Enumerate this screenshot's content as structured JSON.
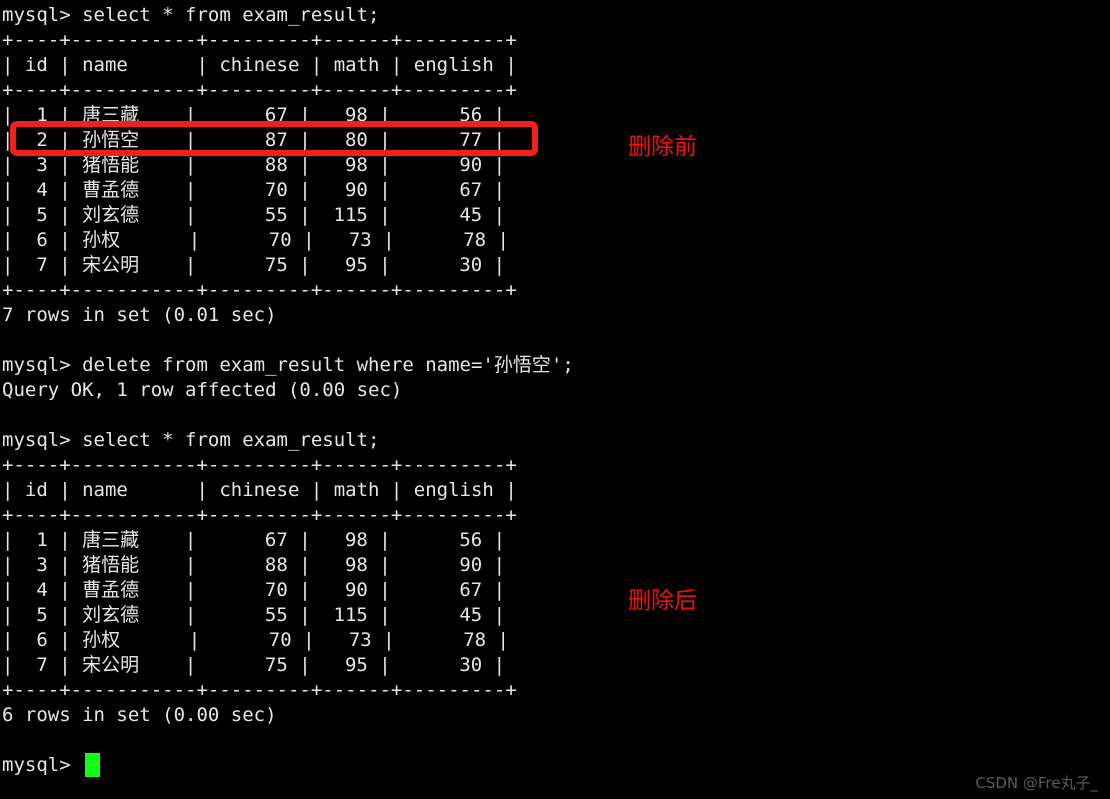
{
  "terminal": {
    "prompt": "mysql> ",
    "background_color": "#000000",
    "text_color": "#e6e6e6",
    "cursor_color": "#13ff13",
    "lines": [
      "mysql> select * from exam_result;",
      "+----+-----------+---------+------+---------+",
      "| id | name      | chinese | math | english |",
      "+----+-----------+---------+------+---------+",
      "|  1 | 唐三藏    |      67 |   98 |      56 |",
      "|  2 | 孙悟空    |      87 |   80 |      77 |",
      "|  3 | 猪悟能    |      88 |   98 |      90 |",
      "|  4 | 曹孟德    |      70 |   90 |      67 |",
      "|  5 | 刘玄德    |      55 |  115 |      45 |",
      "|  6 | 孙权      |      70 |   73 |      78 |",
      "|  7 | 宋公明    |      75 |   95 |      30 |",
      "+----+-----------+---------+------+---------+",
      "7 rows in set (0.01 sec)",
      "",
      "mysql> delete from exam_result where name='孙悟空';",
      "Query OK, 1 row affected (0.00 sec)",
      "",
      "mysql> select * from exam_result;",
      "+----+-----------+---------+------+---------+",
      "| id | name      | chinese | math | english |",
      "+----+-----------+---------+------+---------+",
      "|  1 | 唐三藏    |      67 |   98 |      56 |",
      "|  3 | 猪悟能    |      88 |   98 |      90 |",
      "|  4 | 曹孟德    |      70 |   90 |      67 |",
      "|  5 | 刘玄德    |      55 |  115 |      45 |",
      "|  6 | 孙权      |      70 |   73 |      78 |",
      "|  7 | 宋公明    |      75 |   95 |      30 |",
      "+----+-----------+---------+------+---------+",
      "6 rows in set (0.00 sec)",
      "",
      "mysql> "
    ]
  },
  "queries": {
    "select_before": "select * from exam_result;",
    "delete": "delete from exam_result where name='孙悟空';",
    "delete_result": "Query OK, 1 row affected (0.00 sec)",
    "select_after": "select * from exam_result;",
    "rows_before": "7 rows in set (0.01 sec)",
    "rows_after": "6 rows in set (0.00 sec)"
  },
  "table_before": {
    "columns": [
      "id",
      "name",
      "chinese",
      "math",
      "english"
    ],
    "rows": [
      [
        "1",
        "唐三藏",
        "67",
        "98",
        "56"
      ],
      [
        "2",
        "孙悟空",
        "87",
        "80",
        "77"
      ],
      [
        "3",
        "猪悟能",
        "88",
        "98",
        "90"
      ],
      [
        "4",
        "曹孟德",
        "70",
        "90",
        "67"
      ],
      [
        "5",
        "刘玄德",
        "55",
        "115",
        "45"
      ],
      [
        "6",
        "孙权",
        "70",
        "73",
        "78"
      ],
      [
        "7",
        "宋公明",
        "75",
        "95",
        "30"
      ]
    ],
    "row_count": 7
  },
  "table_after": {
    "columns": [
      "id",
      "name",
      "chinese",
      "math",
      "english"
    ],
    "rows": [
      [
        "1",
        "唐三藏",
        "67",
        "98",
        "56"
      ],
      [
        "3",
        "猪悟能",
        "88",
        "98",
        "90"
      ],
      [
        "4",
        "曹孟德",
        "70",
        "90",
        "67"
      ],
      [
        "5",
        "刘玄德",
        "55",
        "115",
        "45"
      ],
      [
        "6",
        "孙权",
        "70",
        "73",
        "78"
      ],
      [
        "7",
        "宋公明",
        "75",
        "95",
        "30"
      ]
    ],
    "row_count": 6
  },
  "annotations": {
    "before_label": "删除前",
    "after_label": "删除后",
    "color": "#f4110b",
    "highlight_color": "#f41f16",
    "highlighted_row_id": "2"
  },
  "watermark": {
    "text": "CSDN @Fre丸子_"
  }
}
